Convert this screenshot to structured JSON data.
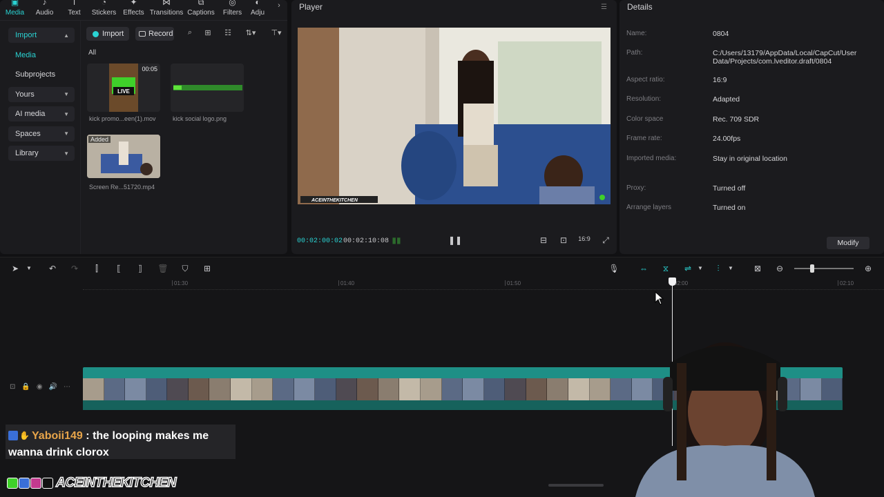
{
  "media_toolbar": {
    "tabs": [
      {
        "label": "Media",
        "icon": "media-icon",
        "active": true
      },
      {
        "label": "Audio",
        "icon": "audio-icon"
      },
      {
        "label": "Text",
        "icon": "text-icon"
      },
      {
        "label": "Stickers",
        "icon": "stickers-icon"
      },
      {
        "label": "Effects",
        "icon": "effects-icon"
      },
      {
        "label": "Transitions",
        "icon": "transitions-icon"
      },
      {
        "label": "Captions",
        "icon": "captions-icon"
      },
      {
        "label": "Filters",
        "icon": "filters-icon"
      },
      {
        "label": "Adju",
        "icon": "adjust-icon"
      }
    ]
  },
  "media_sidebar": {
    "items": [
      {
        "label": "Import"
      },
      {
        "label": "Media"
      },
      {
        "label": "Subprojects"
      },
      {
        "label": "Yours"
      },
      {
        "label": "AI media"
      },
      {
        "label": "Spaces"
      },
      {
        "label": "Library"
      }
    ]
  },
  "media_actions": {
    "import_label": "Import",
    "record_label": "Record",
    "all_label": "All"
  },
  "media_items": [
    {
      "label": "kick promo...een(1).mov",
      "duration": "00:05",
      "added": ""
    },
    {
      "label": "kick social logo.png",
      "duration": "",
      "added": ""
    },
    {
      "label": "Screen Re...51720.mp4",
      "duration": "",
      "added": "Added"
    }
  ],
  "player": {
    "title": "Player",
    "current_time": "00:02:00:02",
    "total_time": "00:02:10:08",
    "current_color": "#2ad3d3",
    "watermark": "ACEINTHEKITCHEN"
  },
  "details": {
    "title": "Details",
    "rows": [
      {
        "key": "Name:",
        "value": "0804"
      },
      {
        "key": "Path:",
        "value": "C:/Users/13179/AppData/Local/CapCut/User Data/Projects/com.lveditor.draft/0804"
      },
      {
        "key": "Aspect ratio:",
        "value": "16:9"
      },
      {
        "key": "Resolution:",
        "value": "Adapted"
      },
      {
        "key": "Color space",
        "value": "Rec. 709 SDR"
      },
      {
        "key": "Frame rate:",
        "value": "24.00fps"
      },
      {
        "key": "Imported media:",
        "value": "Stay in original location"
      },
      {
        "key": "Proxy:",
        "value": "Turned off"
      },
      {
        "key": "Arrange layers",
        "value": "Turned on"
      }
    ],
    "modify_label": "Modify"
  },
  "timeline": {
    "ticks": [
      "01:30",
      "01:40",
      "01:50",
      "02:00",
      "02:10"
    ],
    "clip_color": "#1e8f86"
  },
  "chat": {
    "username": "Yaboii149",
    "separator": ":",
    "message": "the looping makes me wanna drink clorox",
    "username_color": "#e8a54a"
  },
  "brand": {
    "name": "ACEINTHEKITCHEN"
  },
  "colors": {
    "accent": "#2ad3d3",
    "panel": "#1b1b1e",
    "background": "#111113"
  }
}
